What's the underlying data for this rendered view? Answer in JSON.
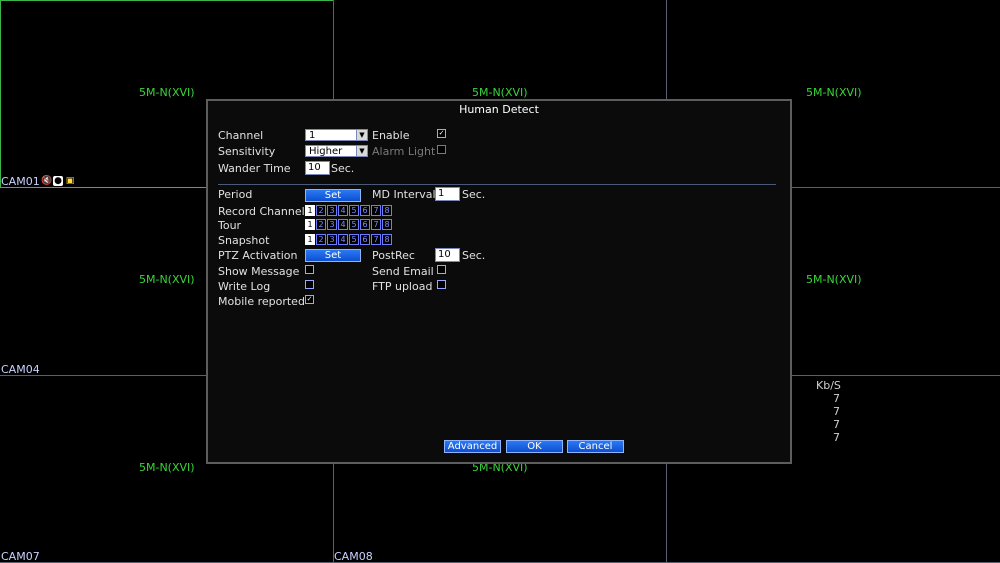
{
  "grid": {
    "cells": [
      {
        "stream_label": "5M-N(XVI)"
      },
      {
        "stream_label": "5M-N(XVI)"
      },
      {
        "stream_label": "5M-N(XVI)"
      },
      {
        "stream_label": "5M-N(XVI)"
      },
      {
        "stream_label": "5M-N(XVI)"
      },
      {
        "stream_label": "5M-N(XVI)"
      },
      {
        "stream_label": "5M-N(XVI)"
      }
    ],
    "cam_names": [
      "CAM01",
      "CAM04",
      "CAM07",
      "CAM08"
    ],
    "cam01_icons": [
      "mute-icon",
      "camera-icon",
      "record-icon"
    ],
    "kbs_header": "Kb/S",
    "kbs_values": [
      "7",
      "7",
      "7",
      "7"
    ]
  },
  "dialog": {
    "title": "Human Detect",
    "channel": {
      "label": "Channel",
      "value": "1"
    },
    "enable": {
      "label": "Enable",
      "checked": true
    },
    "sensitivity": {
      "label": "Sensitivity",
      "value": "Higher"
    },
    "alarm_light": {
      "label": "Alarm Light",
      "checked": false
    },
    "wander_time": {
      "label": "Wander Time",
      "value": "10",
      "unit": "Sec."
    },
    "period": {
      "label": "Period",
      "button": "Set"
    },
    "md_interval": {
      "label": "MD Interval",
      "value": "1",
      "unit": "Sec."
    },
    "record_channel": {
      "label": "Record Channel",
      "channels": [
        "1",
        "2",
        "3",
        "4",
        "5",
        "6",
        "7",
        "8"
      ],
      "selected": [
        "1"
      ]
    },
    "tour": {
      "label": "Tour",
      "channels": [
        "1",
        "2",
        "3",
        "4",
        "5",
        "6",
        "7",
        "8"
      ],
      "selected": [
        "1"
      ]
    },
    "snapshot": {
      "label": "Snapshot",
      "channels": [
        "1",
        "2",
        "3",
        "4",
        "5",
        "6",
        "7",
        "8"
      ],
      "selected": [
        "1"
      ]
    },
    "ptz_activation": {
      "label": "PTZ Activation",
      "button": "Set"
    },
    "postrec": {
      "label": "PostRec",
      "value": "10",
      "unit": "Sec."
    },
    "show_message": {
      "label": "Show Message",
      "checked": false
    },
    "send_email": {
      "label": "Send Email",
      "checked": false
    },
    "write_log": {
      "label": "Write Log",
      "checked": false
    },
    "ftp_upload": {
      "label": "FTP upload",
      "checked": false
    },
    "mobile_reported": {
      "label": "Mobile reported",
      "checked": true
    },
    "buttons": {
      "advanced": "Advanced",
      "ok": "OK",
      "cancel": "Cancel"
    }
  }
}
